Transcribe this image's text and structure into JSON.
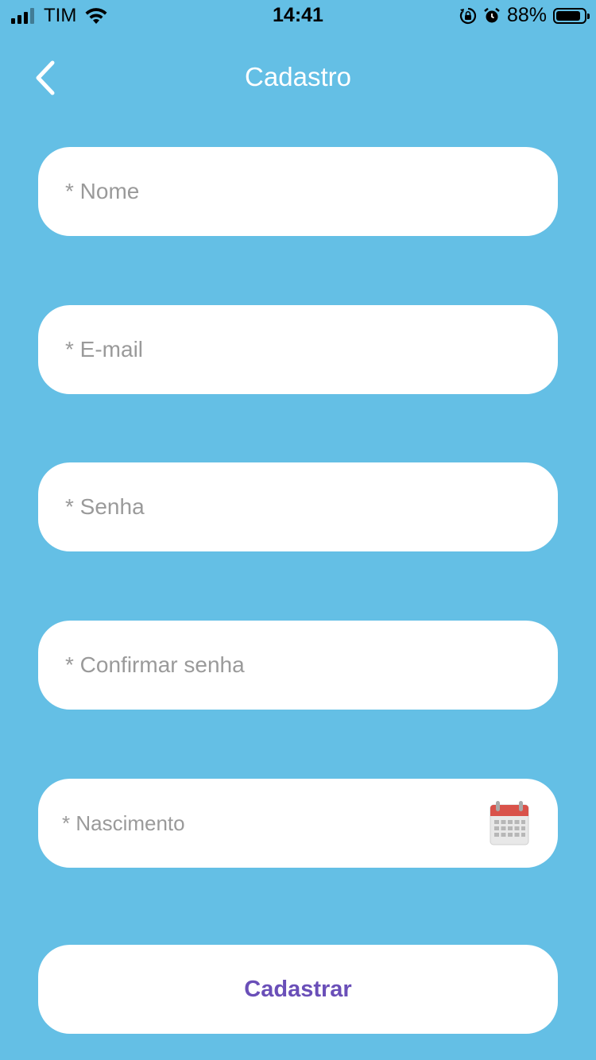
{
  "status_bar": {
    "carrier": "TIM",
    "time": "14:41",
    "battery": "88%",
    "battery_level": 0.88
  },
  "header": {
    "title": "Cadastro",
    "back_icon": "chevron-left-icon"
  },
  "form": {
    "name_placeholder": "* Nome",
    "email_placeholder": "* E-mail",
    "password_placeholder": "* Senha",
    "confirm_password_placeholder": "* Confirmar senha",
    "birthdate_placeholder": "* Nascimento",
    "calendar_icon": "calendar-icon",
    "submit_label": "Cadastrar"
  },
  "colors": {
    "background": "#64bfe5",
    "field_background": "#ffffff",
    "placeholder": "#9a9a9a",
    "submit_text": "#6a4fb8",
    "calendar_header": "#d9524a"
  }
}
